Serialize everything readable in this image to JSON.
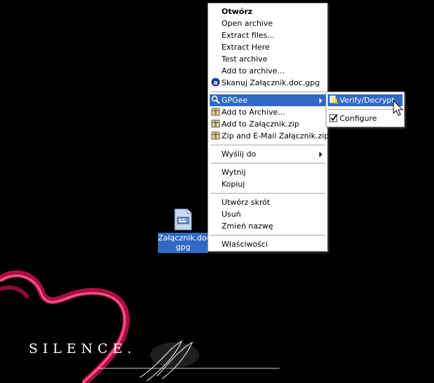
{
  "wallpaper": {
    "text": "SILENCE.",
    "heart_color": "#d4145a"
  },
  "desktop_icon": {
    "caption_line1": "Załącznik.doc.",
    "caption_line2": "gpg",
    "icon": "document-icon"
  },
  "context_menu": {
    "items": [
      {
        "label": "Otwórz",
        "bold": true
      },
      {
        "label": "Open archive"
      },
      {
        "label": "Extract files..."
      },
      {
        "label": "Extract Here"
      },
      {
        "label": "Test archive"
      },
      {
        "label": "Add to archive..."
      },
      {
        "label": "Skanuj Załącznik.doc.gpg",
        "icon": "antivirus-icon"
      },
      {
        "label": "GPGee",
        "icon": "gpgee-icon",
        "submenu": true,
        "highlighted": true
      },
      {
        "label": "Add to Archive...",
        "icon": "archive-icon"
      },
      {
        "label": "Add to Załącznik.zip",
        "icon": "archive-icon"
      },
      {
        "label": "Zip and E-Mail Załącznik.zip",
        "icon": "archive-icon"
      },
      {
        "label": "Wyślij do",
        "submenu": true
      },
      {
        "label": "Wytnij"
      },
      {
        "label": "Kopiuj"
      },
      {
        "label": "Utwórz skrót"
      },
      {
        "label": "Usuń"
      },
      {
        "label": "Zmień nazwę"
      },
      {
        "label": "Właściwości"
      }
    ]
  },
  "submenu": {
    "items": [
      {
        "label": "Verify/Decrypt",
        "icon": "verify-icon",
        "highlighted": true
      },
      {
        "label": "Configure",
        "icon": "configure-check-icon"
      }
    ]
  },
  "colors": {
    "highlight": "#316ac5",
    "background": "#000000",
    "menu_bg": "#ffffff"
  }
}
